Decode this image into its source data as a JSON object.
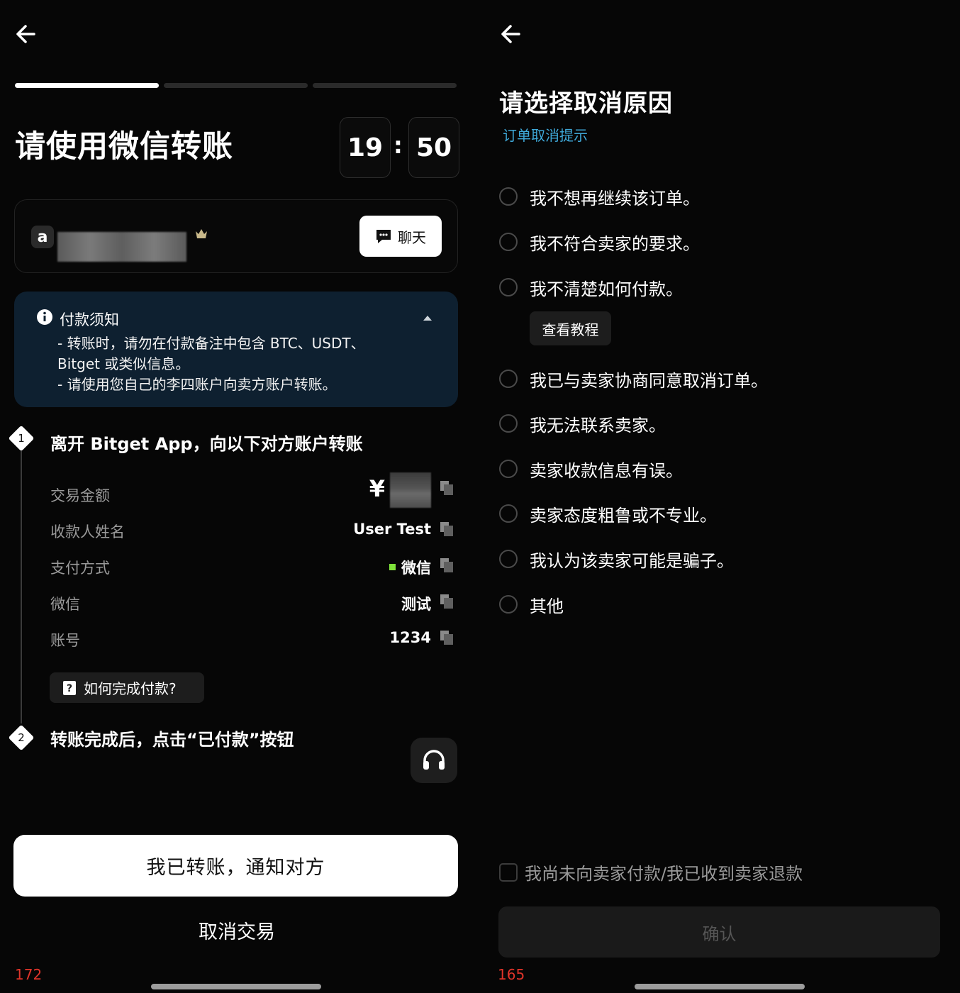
{
  "left": {
    "title": "请使用微信转账",
    "timer": {
      "minutes": "19",
      "colon": ":",
      "seconds": "50"
    },
    "progress": {
      "step": 1,
      "total": 3
    },
    "seller": {
      "avatar_letter": "a"
    },
    "chat_button_label": "聊天",
    "notice": {
      "title": "付款须知",
      "lines": [
        "- 转账时，请勿在付款备注中包含 BTC、USDT、",
        "Bitget 或类似信息。",
        "- 请使用您自己的李四账户向卖方账户转账。"
      ]
    },
    "step1": {
      "number": "1",
      "text": "离开 Bitget App，向以下对方账户转账"
    },
    "details": [
      {
        "label": "交易金额",
        "value": "¥"
      },
      {
        "label": "收款人姓名",
        "value": "User Test"
      },
      {
        "label": "支付方式",
        "value": "微信"
      },
      {
        "label": "微信",
        "value": "测试"
      },
      {
        "label": "账号",
        "value": "1234"
      }
    ],
    "howto_label": "如何完成付款?",
    "step2": {
      "number": "2",
      "text": "转账完成后，点击“已付款”按钮"
    },
    "primary_button": "我已转账，通知对方",
    "cancel_link": "取消交易",
    "debug_number": "172"
  },
  "right": {
    "title": "请选择取消原因",
    "subtitle_link": "订单取消提示",
    "reasons": [
      "我不想再继续该订单。",
      "我不符合卖家的要求。",
      "我不清楚如何付款。",
      "我已与卖家协商同意取消订单。",
      "我无法联系卖家。",
      "卖家收款信息有误。",
      "卖家态度粗鲁或不专业。",
      "我认为该卖家可能是骗子。",
      "其他"
    ],
    "tutorial_label": "查看教程",
    "confirm_check": "我尚未向卖家付款/我已收到卖家退款",
    "confirm_button": "确认",
    "debug_number": "165"
  },
  "colors": {
    "background": "#060606",
    "notice_bg": "#0e2030",
    "link": "#3fa8d8",
    "wechat_green": "#7fe23a",
    "debug_red": "#e0342a"
  },
  "icons": [
    "back-arrow-icon",
    "chat-icon",
    "info-icon",
    "chevron-up-icon",
    "copy-icon",
    "help-book-icon",
    "headset-icon"
  ]
}
